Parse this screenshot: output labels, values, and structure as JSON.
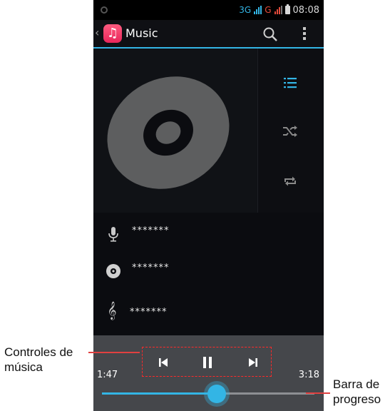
{
  "status_bar": {
    "network_label": "3G",
    "second_network_label": "G",
    "time": "08:08"
  },
  "action_bar": {
    "title": "Music",
    "icons": [
      "back-caret-icon",
      "music-app-icon",
      "search-icon",
      "overflow-menu-icon"
    ]
  },
  "side_controls": {
    "icons": [
      "playlist-icon",
      "shuffle-icon",
      "repeat-icon"
    ]
  },
  "track_info": {
    "rows": [
      {
        "icon": "microphone-icon",
        "text": "*******"
      },
      {
        "icon": "album-disc-icon",
        "text": "*******"
      },
      {
        "icon": "treble-clef-icon",
        "text": "*******"
      }
    ]
  },
  "player": {
    "elapsed": "1:47",
    "duration": "3:18",
    "progress_fraction": 0.54,
    "buttons": [
      "previous-icon",
      "pause-icon",
      "next-icon"
    ]
  },
  "annotations": {
    "controls_label_line1": "Controles de",
    "controls_label_line2": "música",
    "progress_label_line1": "Barra de",
    "progress_label_line2": "progreso"
  },
  "colors": {
    "accent": "#33b5e5",
    "callout_line": "#e04040",
    "dashed_box": "#ff2a2a"
  }
}
